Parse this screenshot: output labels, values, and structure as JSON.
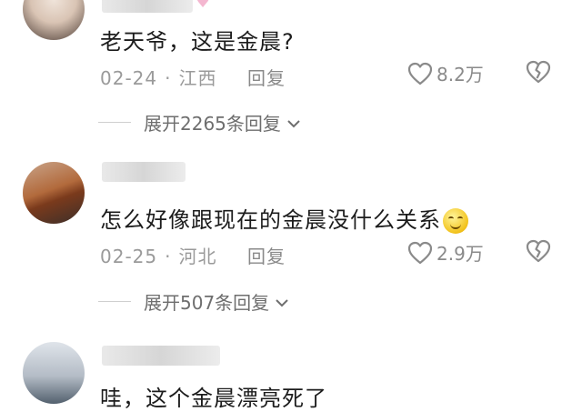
{
  "comments": [
    {
      "text": "老天爷，这是金晨?",
      "date": "02-24",
      "location": "江西",
      "reply_label": "回复",
      "likes": "8.2万",
      "expand_label": "展开2265条回复"
    },
    {
      "text": "怎么好像跟现在的金晨没什么关系",
      "date": "02-25",
      "location": "河北",
      "reply_label": "回复",
      "likes": "2.9万",
      "expand_label": "展开507条回复"
    },
    {
      "text": "哇，这个金晨漂亮死了"
    }
  ],
  "meta_separator": "·",
  "icons": {
    "like": "heart-outline-icon",
    "dislike": "broken-heart-icon",
    "expand": "chevron-down-icon",
    "emoji": "smile-emoji-icon",
    "badge": "pink-heart-icon"
  },
  "colors": {
    "text": "#1c1c1c",
    "meta": "#9a9a9a",
    "badge": "#f4b7d0"
  }
}
